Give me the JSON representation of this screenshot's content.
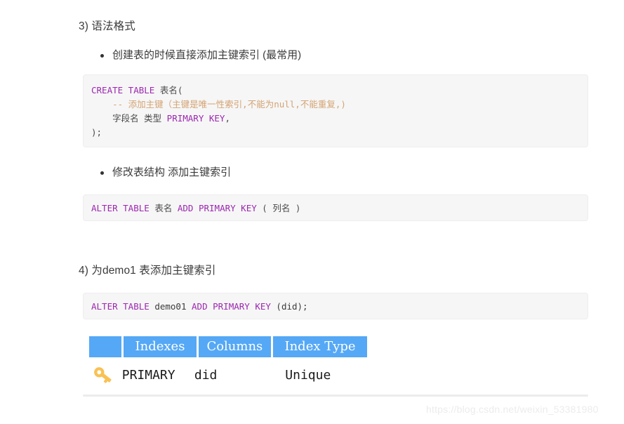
{
  "headings": {
    "section3": "3) 语法格式",
    "section4": "4) 为demo1 表添加主键索引"
  },
  "bullets": [
    {
      "text": "创建表的时候直接添加主键索引 (最常用)"
    },
    {
      "text": "修改表结构 添加主键索引"
    }
  ],
  "code_blocks": {
    "create_table": {
      "line1_kw": "CREATE TABLE",
      "line1_rest": " 表名(",
      "line2_indent": "    ",
      "line2_comment": "-- 添加主键（主键是唯一性索引,不能为null,不能重复,)",
      "line3_indent": "    ",
      "line3_cn": "字段名 类型 ",
      "line3_kw": "PRIMARY KEY",
      "line3_tail": ",",
      "line4": ");"
    },
    "alter_generic": {
      "kw1": "ALTER TABLE",
      "mid": " 表名 ",
      "kw2": "ADD PRIMARY KEY",
      "tail": " ( 列名 )"
    },
    "alter_demo": {
      "kw1": "ALTER TABLE",
      "table_name": " demo01 ",
      "kw2": "ADD PRIMARY KEY",
      "tail": " (did);"
    }
  },
  "result_table": {
    "headers": [
      "",
      "Indexes",
      "Columns",
      "Index Type"
    ],
    "rows": [
      {
        "icon": "key-icon",
        "indexes": "PRIMARY",
        "columns": "did",
        "index_type": "Unique"
      }
    ]
  },
  "watermark": "https://blog.csdn.net/weixin_53381980",
  "colors": {
    "code_background": "#f6f6f6",
    "keyword": "#9c27b0",
    "comment": "#d4a373",
    "table_header": "#55a8f5",
    "key_icon": "#f9c154"
  }
}
